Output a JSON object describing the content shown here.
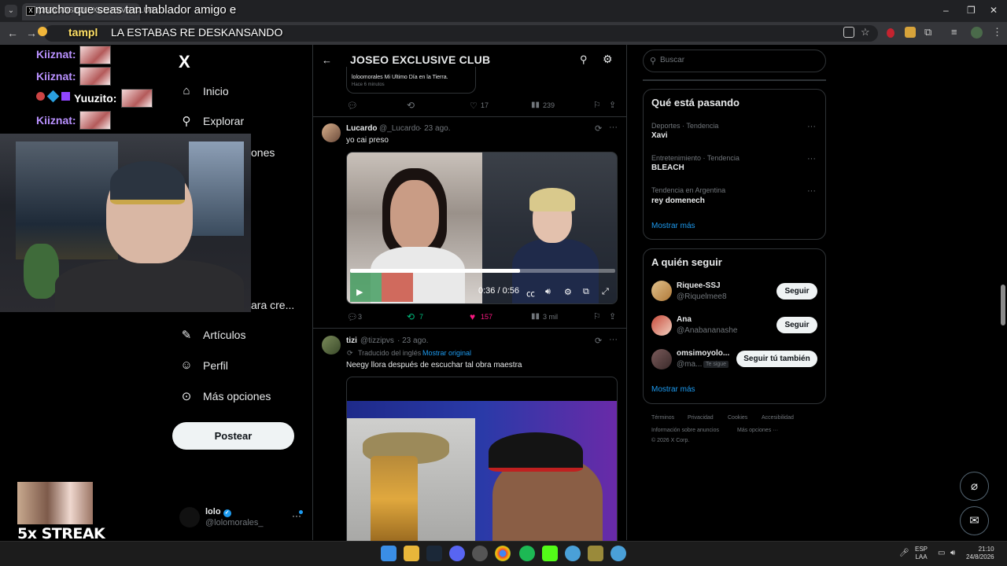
{
  "browser": {
    "tab_title": "(152) JOSEO EXCLUSIVE CLUB",
    "url_overlay": "LA ESTABAS RE DESKANSANDO",
    "url_prefix": "tampl"
  },
  "overlay": {
    "top_message": "mucho que seas tan hablador amigo e",
    "chat": [
      {
        "user": "Kiiznat:"
      },
      {
        "user": "Kiiznat:"
      },
      {
        "user": "Yuuzito:"
      },
      {
        "user": "Kiiznat:"
      }
    ],
    "streak": "5x STREAK",
    "partial_nav_1": "ones",
    "partial_nav_2": "ara cre..."
  },
  "x_nav": {
    "logo": "X",
    "items": [
      {
        "label": "Inicio",
        "icon": "home-icon"
      },
      {
        "label": "Explorar",
        "icon": "search-icon"
      },
      {
        "label": "Artículos",
        "icon": "article-icon"
      },
      {
        "label": "Perfil",
        "icon": "profile-icon"
      },
      {
        "label": "Más opciones",
        "icon": "more-options-icon"
      }
    ],
    "post_button": "Postear",
    "account": {
      "name": "lolo",
      "handle": "@lolomorales_"
    }
  },
  "header": {
    "title": "JOSEO EXCLUSIVE CLUB"
  },
  "quoted": {
    "text": "loloomorales Mi Ultimo Día en la Tierra.",
    "time": "Hace 6 minutos"
  },
  "post0_actions": {
    "replies": "",
    "reposts": "",
    "likes": "17",
    "views": "239"
  },
  "post1": {
    "name": "Lucardo",
    "handle": "@_Lucardo",
    "date": "· 23 ago.",
    "text": "yo cai preso",
    "video_time": "0:36 / 0:56",
    "progress": 0.64,
    "actions": {
      "replies": "3",
      "reposts": "7",
      "likes": "157",
      "views": "3 mil"
    }
  },
  "post2": {
    "name": "tizi",
    "handle": "@tizzipvs",
    "date": "· 23 ago.",
    "translated": "Traducido del inglés",
    "show_original": "Mostrar original",
    "text": "Neegy llora después de escuchar tal obra maestra"
  },
  "search": {
    "placeholder": "Buscar"
  },
  "trends": {
    "title": "Qué está pasando",
    "items": [
      {
        "meta": "Deportes · Tendencia",
        "name": "Xavi"
      },
      {
        "meta": "Entretenimiento · Tendencia",
        "name": "BLEACH"
      },
      {
        "meta": "Tendencia en Argentina",
        "name": "rey domenech"
      }
    ],
    "show_more": "Mostrar más"
  },
  "who_to_follow": {
    "title": "A quién seguir",
    "items": [
      {
        "name": "Riquee-SSJ",
        "handle": "@Riquelmee8",
        "button": "Seguir"
      },
      {
        "name": "Ana",
        "handle": "@Anabananashe",
        "button": "Seguir"
      },
      {
        "name": "omsimoyolo...",
        "handle": "@ma...",
        "button": "Seguir tú también",
        "badge": "Te sigue"
      }
    ],
    "show_more": "Mostrar más"
  },
  "footer": {
    "links": [
      "Términos",
      "Privacidad",
      "Cookies",
      "Accesibilidad",
      "Información sobre anuncios",
      "Más opciones ···"
    ],
    "copyright": "© 2026 X Corp."
  },
  "taskbar": {
    "lang_1": "ESP",
    "lang_2": "LAA",
    "time": "21:10",
    "date": "24/8/2026"
  }
}
